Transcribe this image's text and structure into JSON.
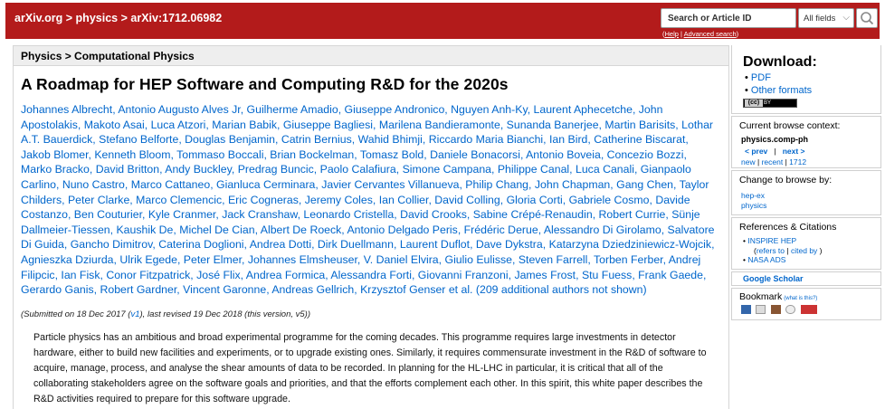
{
  "header": {
    "breadcrumb": [
      "arXiv.org",
      ">",
      "physics",
      ">",
      "arXiv:1712.06982"
    ],
    "search_placeholder": "Search or Article ID",
    "search_field": "All fields",
    "help_link": "Help",
    "help_sep": "|",
    "advanced_link": "Advanced search"
  },
  "colors": {
    "brand": "#b31b1b",
    "link": "#0066cc"
  },
  "subject_bar": "Physics > Computational Physics",
  "paper": {
    "title": "A Roadmap for HEP Software and Computing R&D for the 2020s",
    "authors": [
      "Johannes Albrecht",
      "Antonio Augusto Alves Jr",
      "Guilherme Amadio",
      "Giuseppe Andronico",
      "Nguyen Anh-Ky",
      "Laurent Aphecetche",
      "John Apostolakis",
      "Makoto Asai",
      "Luca Atzori",
      "Marian Babik",
      "Giuseppe Bagliesi",
      "Marilena Bandieramonte",
      "Sunanda Banerjee",
      "Martin Barisits",
      "Lothar A.T. Bauerdick",
      "Stefano Belforte",
      "Douglas Benjamin",
      "Catrin Bernius",
      "Wahid Bhimji",
      "Riccardo Maria Bianchi",
      "Ian Bird",
      "Catherine Biscarat",
      "Jakob Blomer",
      "Kenneth Bloom",
      "Tommaso Boccali",
      "Brian Bockelman",
      "Tomasz Bold",
      "Daniele Bonacorsi",
      "Antonio Boveia",
      "Concezio Bozzi",
      "Marko Bracko",
      "David Britton",
      "Andy Buckley",
      "Predrag Buncic",
      "Paolo Calafiura",
      "Simone Campana",
      "Philippe Canal",
      "Luca Canali",
      "Gianpaolo Carlino",
      "Nuno Castro",
      "Marco Cattaneo",
      "Gianluca Cerminara",
      "Javier Cervantes Villanueva",
      "Philip Chang",
      "John Chapman",
      "Gang Chen",
      "Taylor Childers",
      "Peter Clarke",
      "Marco Clemencic",
      "Eric Cogneras",
      "Jeremy Coles",
      "Ian Collier",
      "David Colling",
      "Gloria Corti",
      "Gabriele Cosmo",
      "Davide Costanzo",
      "Ben Couturier",
      "Kyle Cranmer",
      "Jack Cranshaw",
      "Leonardo Cristella",
      "David Crooks",
      "Sabine Crépé-Renaudin",
      "Robert Currie",
      "Sünje Dallmeier-Tiessen",
      "Kaushik De",
      "Michel De Cian",
      "Albert De Roeck",
      "Antonio Delgado Peris",
      "Frédéric Derue",
      "Alessandro Di Girolamo",
      "Salvatore Di Guida",
      "Gancho Dimitrov",
      "Caterina Doglioni",
      "Andrea Dotti",
      "Dirk Duellmann",
      "Laurent Duflot",
      "Dave Dykstra",
      "Katarzyna Dziedziniewicz-Wojcik",
      "Agnieszka Dziurda",
      "Ulrik Egede",
      "Peter Elmer",
      "Johannes Elmsheuser",
      "V. Daniel Elvira",
      "Giulio Eulisse",
      "Steven Farrell",
      "Torben Ferber",
      "Andrej Filipcic",
      "Ian Fisk",
      "Conor Fitzpatrick",
      "José Flix",
      "Andrea Formica",
      "Alessandra Forti",
      "Giovanni Franzoni",
      "James Frost",
      "Stu Fuess",
      "Frank Gaede",
      "Gerardo Ganis",
      "Robert Gardner",
      "Vincent Garonne",
      "Andreas Gellrich",
      "Krzysztof Genser et al."
    ],
    "additional_authors": "(209 additional authors not shown)",
    "submission_prefix": "(Submitted on 18 Dec 2017 (",
    "submission_v1": "v1",
    "submission_suffix": "), last revised 19 Dec 2018 (this version, v5))",
    "abstract": "Particle physics has an ambitious and broad experimental programme for the coming decades. This programme requires large investments in detector hardware, either to build new facilities and experiments, or to upgrade existing ones. Similarly, it requires commensurate investment in the R&D of software to acquire, manage, process, and analyse the shear amounts of data to be recorded. In planning for the HL-LHC in particular, it is critical that all of the collaborating stakeholders agree on the software goals and priorities, and that the efforts complement each other. In this spirit, this white paper describes the R&D activities required to prepare for this software upgrade."
  },
  "sidebar": {
    "download_title": "Download:",
    "download_items": [
      "PDF",
      "Other formats"
    ],
    "license_cc": "(cc)",
    "license_by": "BY",
    "context_title": "Current browse context:",
    "context_category": "physics.comp-ph",
    "prev": "< prev",
    "nav_sep": "|",
    "next": "next >",
    "new": "new",
    "recent": "recent",
    "year": "1712",
    "change_title": "Change to browse by:",
    "change_items": [
      "hep-ex",
      "physics"
    ],
    "refs_title": "References & Citations",
    "inspire": "INSPIRE HEP",
    "inspire_sub_open": "(",
    "refers_to": "refers to",
    "cited_by": "cited by",
    "inspire_sub_close": ")",
    "nasa": "NASA ADS",
    "scholar": "Google Scholar",
    "bookmark_title": "Bookmark",
    "bookmark_what": "(what is this?)"
  }
}
